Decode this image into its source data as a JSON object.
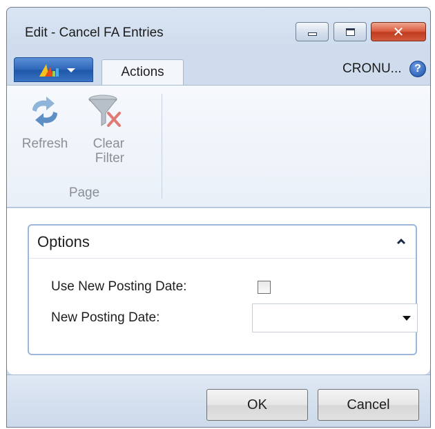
{
  "window": {
    "title": "Edit - Cancel FA Entries",
    "close_glyph": "✕"
  },
  "tabs": {
    "app_menu_icon": "dynamics-logo-icon",
    "actions": "Actions"
  },
  "company": {
    "name": "CRONU...",
    "help_glyph": "?"
  },
  "ribbon": {
    "refresh": {
      "line1": "Refresh",
      "icon": "refresh-icon"
    },
    "clear_filter": {
      "line1": "Clear",
      "line2": "Filter",
      "icon": "clear-filter-icon"
    },
    "group": "Page"
  },
  "options": {
    "title": "Options",
    "use_new_posting_date": {
      "label": "Use New Posting Date:",
      "checked": false
    },
    "new_posting_date": {
      "label": "New Posting Date:",
      "value": ""
    }
  },
  "buttons": {
    "ok": "OK",
    "cancel": "Cancel"
  }
}
